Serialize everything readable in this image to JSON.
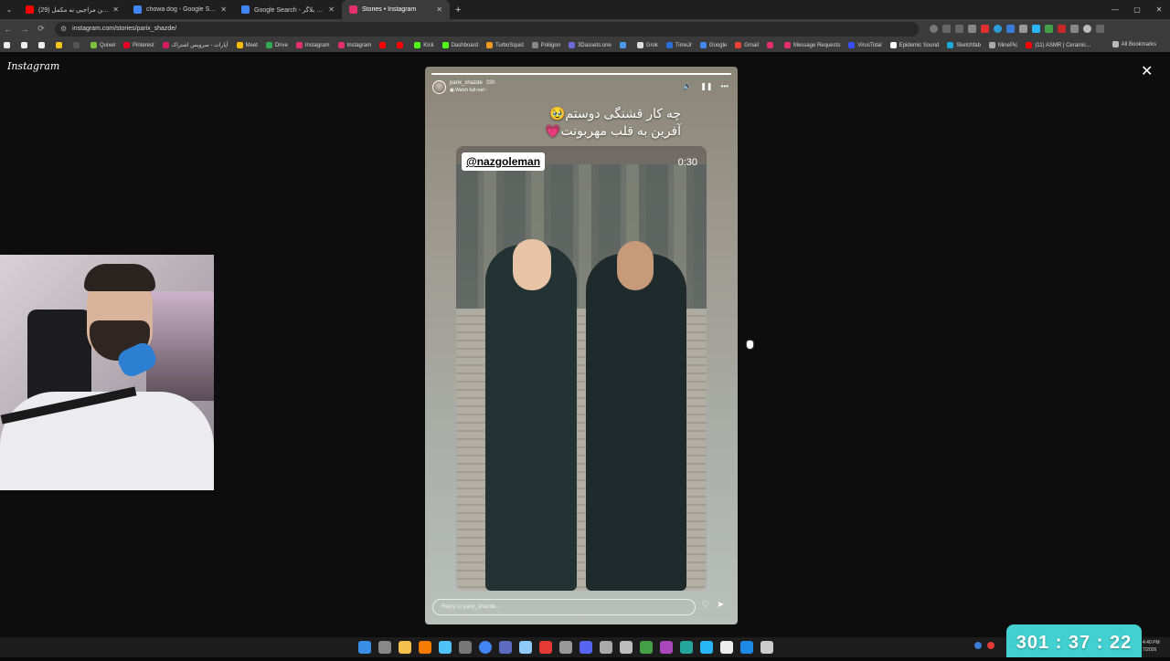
{
  "browser": {
    "tabs": [
      {
        "title": "(29) تفاوت بین مراجبی نه مکمل",
        "icon": "youtube-icon",
        "color": "#ff0000",
        "active": false
      },
      {
        "title": "chowa dog - Google Search",
        "icon": "google-icon",
        "color": "#4285f4",
        "active": false
      },
      {
        "title": "Google Search - شجاعیان بلاگر",
        "icon": "google-icon",
        "color": "#4285f4",
        "active": false
      },
      {
        "title": "Stories • Instagram",
        "icon": "instagram-icon",
        "color": "#e1306c",
        "active": true
      }
    ],
    "url": "instagram.com/stories/parix_shazde/",
    "bookmarks": [
      {
        "label": "Quixel",
        "color": "#7fbf3f"
      },
      {
        "label": "Pinterest",
        "color": "#e60023"
      },
      {
        "label": "آپارات - سرویس اشتراک",
        "color": "#d81b60"
      },
      {
        "label": "Meet",
        "color": "#fbbc04"
      },
      {
        "label": "Drive",
        "color": "#34a853"
      },
      {
        "label": "Instagram",
        "color": "#e1306c"
      },
      {
        "label": "Instagram",
        "color": "#e1306c"
      },
      {
        "label": "",
        "color": "#ff0000"
      },
      {
        "label": "",
        "color": "#ff0000"
      },
      {
        "label": "Kick",
        "color": "#53fc18"
      },
      {
        "label": "Dashboard",
        "color": "#53fc18"
      },
      {
        "label": "TurboSquid",
        "color": "#f29a1f"
      },
      {
        "label": "Poliigon",
        "color": "#888888"
      },
      {
        "label": "3Dassets.one",
        "color": "#6b6bd6"
      },
      {
        "label": "",
        "color": "#4a9be8"
      },
      {
        "label": "Grok",
        "color": "#dddddd"
      },
      {
        "label": "TimeJr",
        "color": "#2b6fd6"
      },
      {
        "label": "Google",
        "color": "#4285f4"
      },
      {
        "label": "Gmail",
        "color": "#ea4335"
      },
      {
        "label": "",
        "color": "#e1306c"
      },
      {
        "label": "Message Requests",
        "color": "#e1306c"
      },
      {
        "label": "VirusTotal",
        "color": "#394eff"
      },
      {
        "label": "Epidemic Sound",
        "color": "#ffffff"
      },
      {
        "label": "Sketchfab",
        "color": "#1caad9"
      },
      {
        "label": "MinePic",
        "color": "#aaaaaa"
      },
      {
        "label": "(11) ASMR | Ceramic...",
        "color": "#ff0000"
      }
    ],
    "all_bookmarks": "All Bookmarks"
  },
  "instagram": {
    "logo": "Instagram",
    "story": {
      "username": "parix_shazde",
      "age": "33h",
      "watch_full": "Watch full reel",
      "caption_line1": "چه کار قشنگی دوستم🥹",
      "caption_line2": "آفرین به قلب مهربونت💗",
      "mention_tag": "@nazgoleman",
      "video_time": "0:30",
      "reply_placeholder": "Reply to parix_shazde...",
      "progress_fraction": 1.0
    }
  },
  "overlay_timer": "301 : 37 : 22",
  "taskbar": {
    "clock_time": "4:40 PM",
    "clock_date": "7/2026"
  }
}
